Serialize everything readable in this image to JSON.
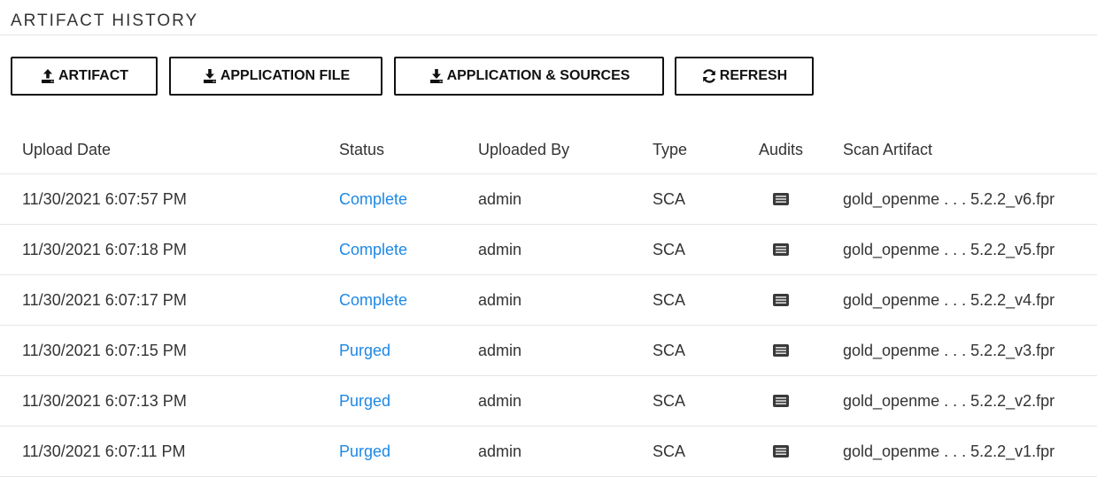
{
  "section": {
    "title": "ARTIFACT HISTORY"
  },
  "toolbar": {
    "artifact_label": "ARTIFACT",
    "application_file_label": "APPLICATION FILE",
    "application_sources_label": "APPLICATION & SOURCES",
    "refresh_label": "REFRESH"
  },
  "table": {
    "columns": {
      "upload_date": "Upload Date",
      "status": "Status",
      "uploaded_by": "Uploaded By",
      "type": "Type",
      "audits": "Audits",
      "scan_artifact": "Scan Artifact"
    },
    "rows": [
      {
        "date": "11/30/2021 6:07:57 PM",
        "status": "Complete",
        "user": "admin",
        "type": "SCA",
        "artifact": "gold_openme . . . 5.2.2_v6.fpr"
      },
      {
        "date": "11/30/2021 6:07:18 PM",
        "status": "Complete",
        "user": "admin",
        "type": "SCA",
        "artifact": "gold_openme . . . 5.2.2_v5.fpr"
      },
      {
        "date": "11/30/2021 6:07:17 PM",
        "status": "Complete",
        "user": "admin",
        "type": "SCA",
        "artifact": "gold_openme . . . 5.2.2_v4.fpr"
      },
      {
        "date": "11/30/2021 6:07:15 PM",
        "status": "Purged",
        "user": "admin",
        "type": "SCA",
        "artifact": "gold_openme . . . 5.2.2_v3.fpr"
      },
      {
        "date": "11/30/2021 6:07:13 PM",
        "status": "Purged",
        "user": "admin",
        "type": "SCA",
        "artifact": "gold_openme . . . 5.2.2_v2.fpr"
      },
      {
        "date": "11/30/2021 6:07:11 PM",
        "status": "Purged",
        "user": "admin",
        "type": "SCA",
        "artifact": "gold_openme . . . 5.2.2_v1.fpr"
      }
    ]
  },
  "icons": {
    "upload": "upload-icon",
    "download": "download-icon",
    "refresh": "refresh-icon",
    "audit": "audit-list-icon"
  },
  "colors": {
    "status_link": "#1e88e5",
    "button_border": "#111111"
  }
}
